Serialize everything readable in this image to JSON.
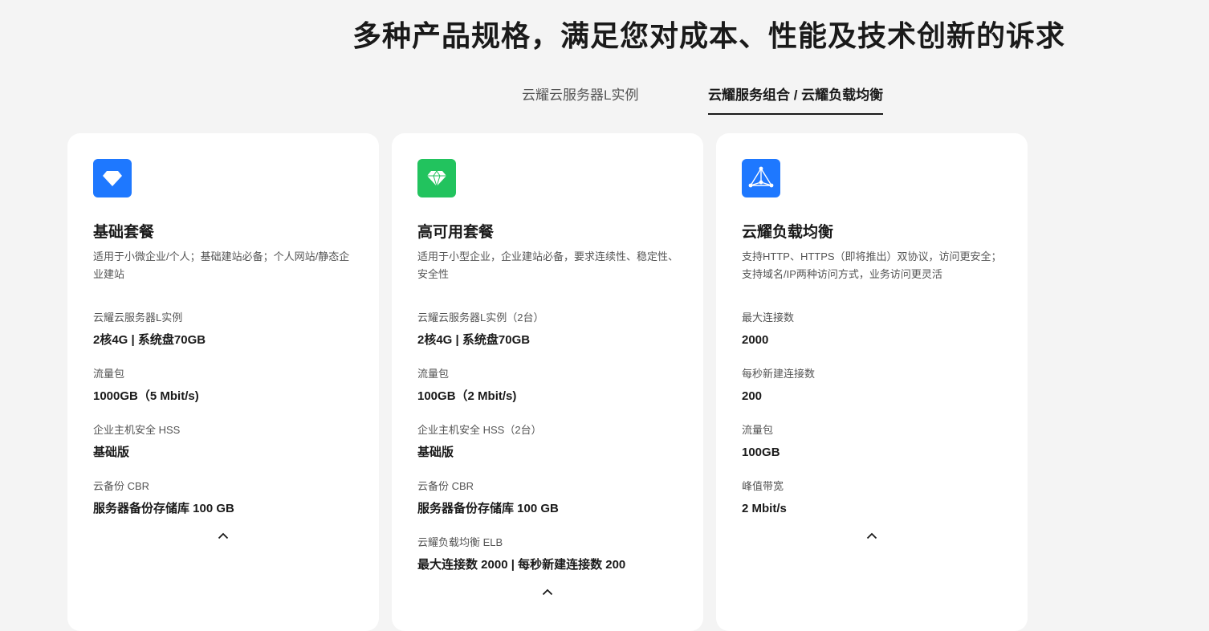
{
  "heading": "多种产品规格，满足您对成本、性能及技术创新的诉求",
  "tabs": [
    {
      "label": "云耀云服务器L实例",
      "active": false
    },
    {
      "label": "云耀服务组合 / 云耀负载均衡",
      "active": true
    }
  ],
  "colors": {
    "blue": "#1e78ff",
    "green": "#22c35e",
    "background": "#f4f4f4",
    "card": "#ffffff"
  },
  "cards": [
    {
      "icon": "diamond-icon",
      "title": "基础套餐",
      "desc": "适用于小微企业/个人；基础建站必备；个人网站/静态企业建站",
      "specs": [
        {
          "label": "云耀云服务器L实例",
          "value": "2核4G | 系统盘70GB"
        },
        {
          "label": "流量包",
          "value": "1000GB（5 Mbit/s)"
        },
        {
          "label": "企业主机安全 HSS",
          "value": "基础版"
        },
        {
          "label": "云备份 CBR",
          "value": "服务器备份存储库 100 GB"
        }
      ]
    },
    {
      "icon": "gem-icon",
      "title": "高可用套餐",
      "desc": "适用于小型企业，企业建站必备，要求连续性、稳定性、安全性",
      "specs": [
        {
          "label": "云耀云服务器L实例（2台）",
          "value": "2核4G | 系统盘70GB"
        },
        {
          "label": "流量包",
          "value": "100GB（2 Mbit/s)"
        },
        {
          "label": "企业主机安全 HSS（2台）",
          "value": "基础版"
        },
        {
          "label": "云备份 CBR",
          "value": "服务器备份存储库 100 GB"
        },
        {
          "label": "云耀负载均衡 ELB",
          "value": "最大连接数 2000 | 每秒新建连接数 200"
        }
      ]
    },
    {
      "icon": "load-balancer-icon",
      "title": "云耀负载均衡",
      "desc": "支持HTTP、HTTPS（即将推出）双协议，访问更安全；支持域名/IP两种访问方式，业务访问更灵活",
      "specs": [
        {
          "label": "最大连接数",
          "value": "2000"
        },
        {
          "label": "每秒新建连接数",
          "value": "200"
        },
        {
          "label": "流量包",
          "value": "100GB"
        },
        {
          "label": "峰值带宽",
          "value": "2 Mbit/s"
        }
      ]
    }
  ]
}
